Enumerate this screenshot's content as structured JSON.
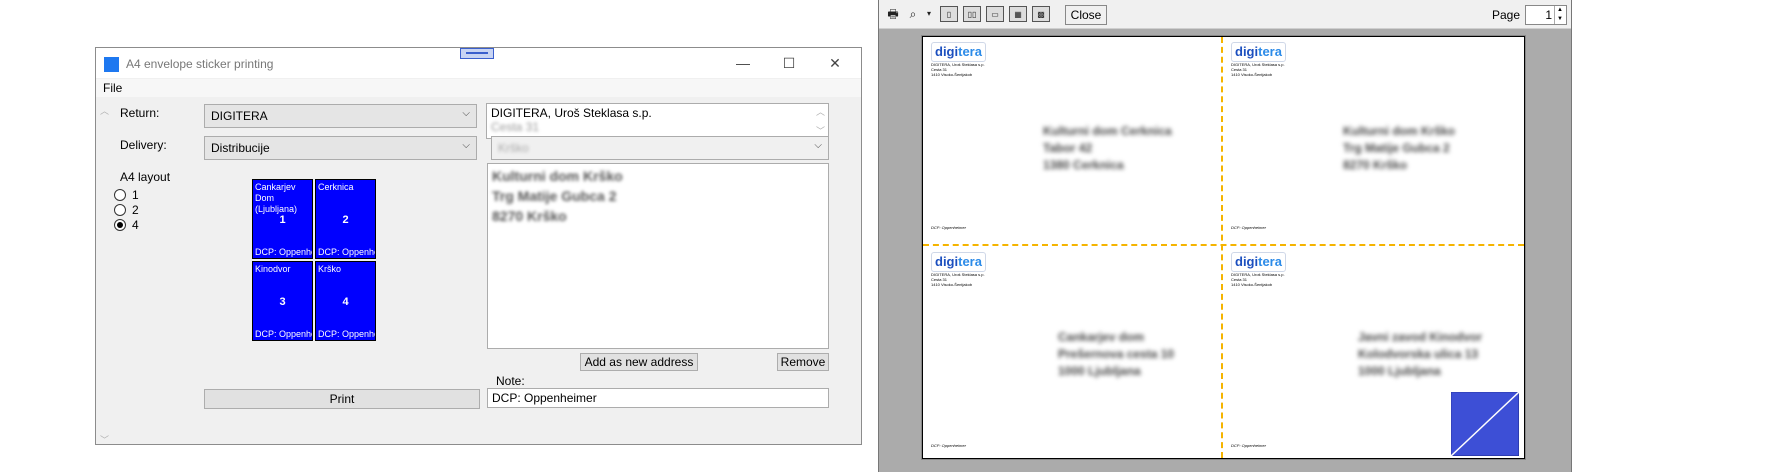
{
  "dialog": {
    "title": "A4 envelope sticker printing",
    "menu": [
      "File"
    ],
    "return_label": "Return:",
    "return_value": "DIGITERA",
    "return_address": [
      "DIGITERA, Uroš Steklasa s.p.",
      "Cesta 31"
    ],
    "delivery_label": "Delivery:",
    "delivery_value": "Distribucije",
    "delivery_filter": "Krško",
    "layout_label": "A4 layout",
    "layout_options": [
      "1",
      "2",
      "4"
    ],
    "layout_selected": "4",
    "tiles": [
      {
        "name": "Cankarjev Dom (Ljubljana)",
        "num": "1",
        "note": "DCP: Oppenhei"
      },
      {
        "name": "Cerknica",
        "num": "2",
        "note": "DCP: Oppenhei"
      },
      {
        "name": "Kinodvor",
        "num": "3",
        "note": "DCP: Oppenhei"
      },
      {
        "name": "Krško",
        "num": "4",
        "note": "DCP: Oppenhei"
      }
    ],
    "delivery_address": [
      "Kulturni dom Krško",
      "Trg Matije Gubca 2",
      "8270 Krško"
    ],
    "add_button": "Add as new address",
    "remove_button": "Remove",
    "note_label": "Note:",
    "note_value": "DCP: Oppenheimer",
    "print_button": "Print",
    "window_controls": {
      "minimize": "—",
      "maximize": "☐",
      "close": "✕"
    }
  },
  "preview": {
    "close_button": "Close",
    "page_label": "Page",
    "page_value": "1",
    "tool_icons": [
      "printer-icon",
      "zoom-icon",
      "one-page-icon",
      "two-page-icon",
      "three-page-icon",
      "four-page-icon",
      "six-page-icon"
    ],
    "stickers": [
      {
        "brand": "digitera",
        "sender": [
          "DIGITERA, Uroš Steklasa s.p.",
          "Cesta 31",
          "1410 Visoko-Šentjakob"
        ],
        "addr": [
          "Kulturni dom Cerknica",
          "Tabor 42",
          "1380 Cerknica"
        ],
        "note": "DCP: Oppenheimer"
      },
      {
        "brand": "digitera",
        "sender": [
          "DIGITERA, Uroš Steklasa s.p.",
          "Cesta 31",
          "1410 Visoko-Šentjakob"
        ],
        "addr": [
          "Kulturni dom Krško",
          "Trg Matije Gubca 2",
          "8270 Krško"
        ],
        "note": "DCP: Oppenheimer"
      },
      {
        "brand": "digitera",
        "sender": [
          "DIGITERA, Uroš Steklasa s.p.",
          "Cesta 31",
          "1410 Visoko-Šentjakob"
        ],
        "addr": [
          "Cankarjev dom",
          "Prešernova cesta 10",
          "1000 Ljubljana"
        ],
        "note": "DCP: Oppenheimer"
      },
      {
        "brand": "digitera",
        "sender": [
          "DIGITERA, Uroš Steklasa s.p.",
          "Cesta 31",
          "1410 Visoko-Šentjakob"
        ],
        "addr": [
          "Javni zavod Kinodvor",
          "Kolodvorska ulica 13",
          "1000 Ljubljana"
        ],
        "note": "DCP: Oppenheimer"
      }
    ],
    "colors": {
      "tile": "#0000ff",
      "cut_line": "#f5b400",
      "corner": "#3d4fd6"
    }
  }
}
